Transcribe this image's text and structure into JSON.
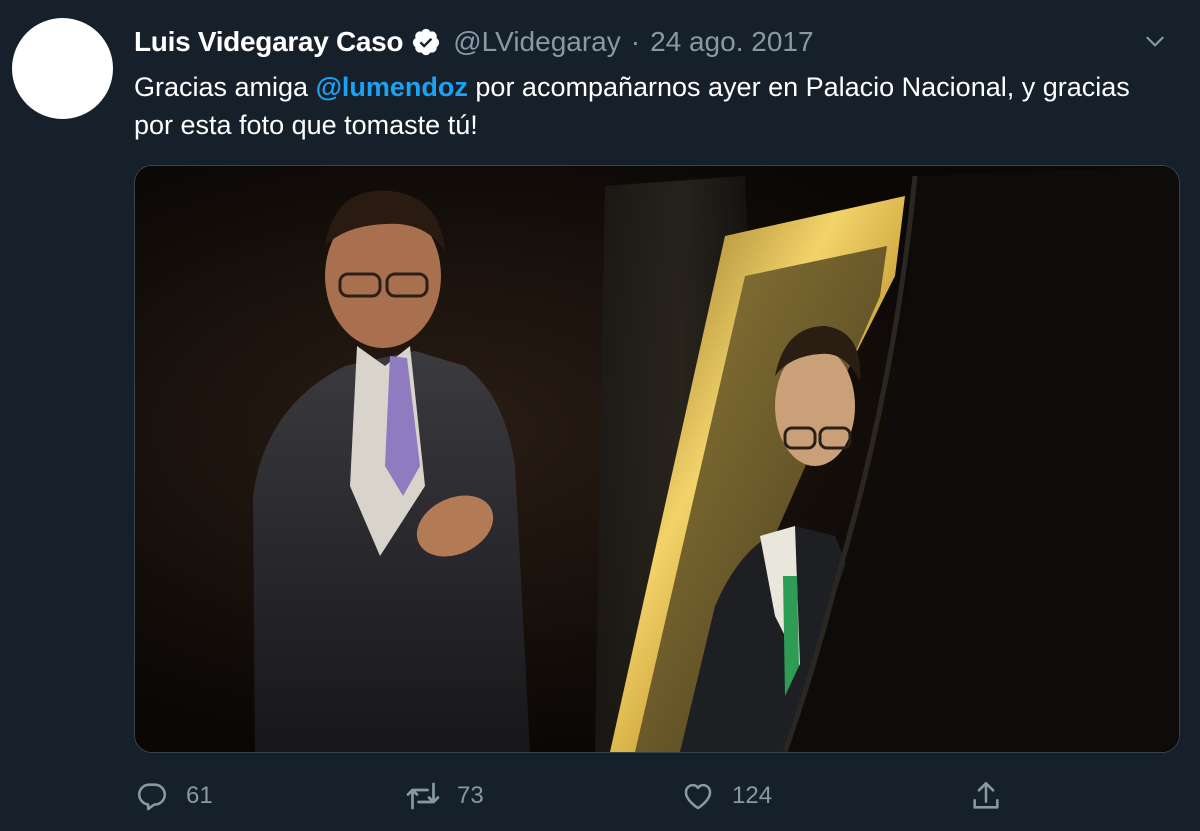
{
  "tweet": {
    "author_name": "Luis Videgaray Caso",
    "handle": "@LVidegaray",
    "separator": "·",
    "date": "24 ago. 2017",
    "text_before": "Gracias amiga ",
    "mention": "@lumendoz",
    "text_after": " por acompañarnos ayer en Palacio Nacional, y gracias por esta foto que tomaste tú!",
    "replies": "61",
    "retweets": "73",
    "likes": "124"
  },
  "icons": {
    "verified": "verified-badge-icon",
    "more": "chevron-down-icon",
    "reply": "reply-icon",
    "retweet": "retweet-icon",
    "like": "heart-icon",
    "share": "share-icon"
  },
  "colors": {
    "background": "#15202b",
    "text": "#ffffff",
    "secondary": "#8899a6",
    "link": "#1da1f2"
  }
}
